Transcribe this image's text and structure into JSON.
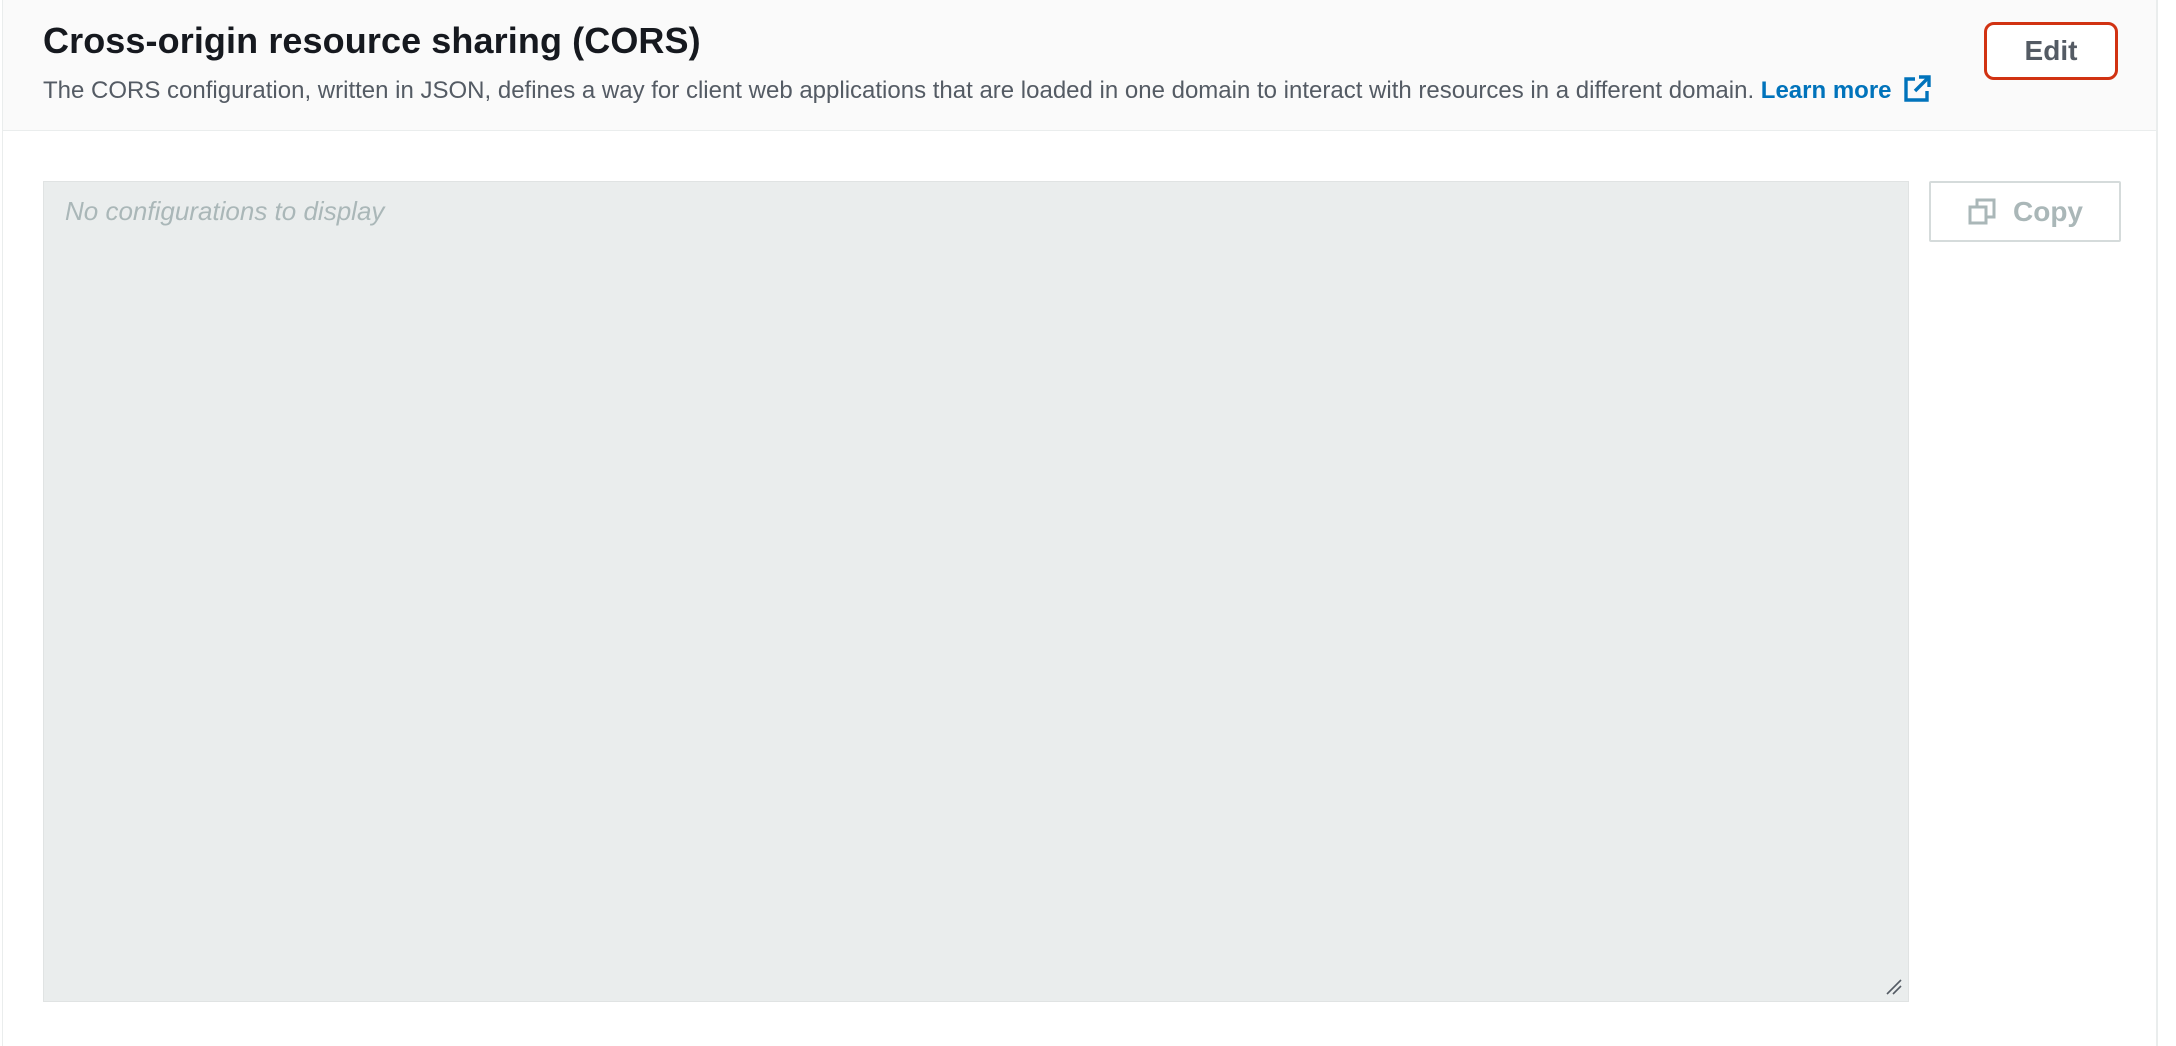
{
  "section": {
    "title": "Cross-origin resource sharing (CORS)",
    "description": "The CORS configuration, written in JSON, defines a way for client web applications that are loaded in one domain to interact with resources in a different domain.",
    "learn_more_label": "Learn more",
    "learn_more_icon": "external-link-icon"
  },
  "actions": {
    "edit_label": "Edit",
    "copy_label": "Copy",
    "copy_icon": "copy-icon"
  },
  "editor": {
    "placeholder": "No configurations to display"
  },
  "colors": {
    "link": "#0073bb",
    "title": "#16191f",
    "body_text": "#545b64",
    "disabled_text": "#aab7b8",
    "editor_background": "#eaeded",
    "edit_highlight": "#d13212"
  }
}
